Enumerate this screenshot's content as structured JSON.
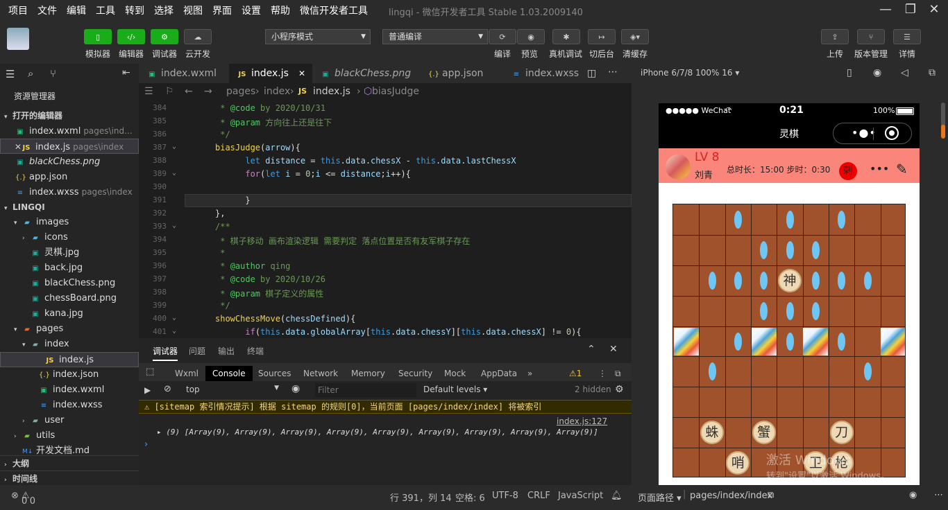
{
  "menubar": {
    "items": [
      "项目",
      "文件",
      "编辑",
      "工具",
      "转到",
      "选择",
      "视图",
      "界面",
      "设置",
      "帮助",
      "微信开发者工具"
    ],
    "title": "lingqi - 微信开发者工具 Stable 1.03.2009140"
  },
  "toolbar": {
    "simulator": "模拟器",
    "editor": "编辑器",
    "debugger": "调试器",
    "cloud": "云开发",
    "mode": "小程序模式",
    "compile_mode": "普通编译",
    "compile": "编译",
    "preview": "预览",
    "real_debug": "真机调试",
    "background": "切后台",
    "clear_cache": "清缓存",
    "upload": "上传",
    "version": "版本管理",
    "details": "详情"
  },
  "sidebar": {
    "title": "资源管理器",
    "open_editors": "打开的编辑器",
    "open_files": [
      {
        "name": "index.wxml",
        "path": "pages\\ind...",
        "type": "wxml"
      },
      {
        "name": "index.js",
        "path": "pages\\index",
        "type": "js"
      },
      {
        "name": "blackChess.png",
        "path": "",
        "type": "png"
      },
      {
        "name": "app.json",
        "path": "",
        "type": "json"
      },
      {
        "name": "index.wxss",
        "path": "pages\\index",
        "type": "wxss"
      }
    ],
    "project": "LINGQI",
    "tree": [
      {
        "name": "images",
        "type": "fold",
        "depth": 1,
        "open": true
      },
      {
        "name": "icons",
        "type": "fold",
        "depth": 2,
        "open": false
      },
      {
        "name": "灵棋.jpg",
        "type": "png",
        "depth": 2
      },
      {
        "name": "back.jpg",
        "type": "png",
        "depth": 2
      },
      {
        "name": "blackChess.png",
        "type": "png",
        "depth": 2
      },
      {
        "name": "chessBoard.png",
        "type": "png",
        "depth": 2
      },
      {
        "name": "kana.jpg",
        "type": "png",
        "depth": 2
      },
      {
        "name": "pages",
        "type": "fold",
        "depth": 1,
        "open": true
      },
      {
        "name": "index",
        "type": "fold",
        "depth": 2,
        "open": true
      },
      {
        "name": "index.js",
        "type": "js",
        "depth": 3
      },
      {
        "name": "index.json",
        "type": "json",
        "depth": 3
      },
      {
        "name": "index.wxml",
        "type": "wxml",
        "depth": 3
      },
      {
        "name": "index.wxss",
        "type": "wxss",
        "depth": 3
      },
      {
        "name": "user",
        "type": "fold",
        "depth": 2,
        "open": false
      },
      {
        "name": "utils",
        "type": "fold",
        "depth": 1,
        "open": false
      },
      {
        "name": "开发文档.md",
        "type": "md",
        "depth": 1
      }
    ],
    "outline": "大纲",
    "timeline": "时间线"
  },
  "tabs": [
    "index.wxml",
    "index.js",
    "blackChess.png",
    "app.json",
    "index.wxss"
  ],
  "breadcrumb": [
    "pages",
    "index",
    "index.js",
    "biasJudge"
  ],
  "editor": {
    "lines": [
      {
        "n": "384",
        "html": "<span class=\"cm\"> * </span><span class=\"cmk\">@code</span><span class=\"cm\"> by 2020/10/31</span>"
      },
      {
        "n": "385",
        "html": "<span class=\"cm\"> * </span><span class=\"cmk\">@param</span><span class=\"cm\"> 方向往上还是往下</span>"
      },
      {
        "n": "386",
        "html": "<span class=\"cm\"> */</span>"
      },
      {
        "n": "387",
        "html": "<span class=\"fn\">biasJudge</span>(<span class=\"pr\">arrow</span>){"
      },
      {
        "n": "388",
        "html": "      <span class=\"kw\">let</span> <span class=\"pr\">distance</span> = <span class=\"kw\">this</span>.<span class=\"pr\">data</span>.<span class=\"pr\">chessX</span> - <span class=\"kw\">this</span>.<span class=\"pr\">data</span>.<span class=\"pr\">lastChessX</span>"
      },
      {
        "n": "389",
        "html": "      <span class=\"pm\">for</span>(<span class=\"kw\">let</span> <span class=\"pr\">i</span> = <span class=\"num\">0</span>;<span class=\"pr\">i</span> &lt;= <span class=\"pr\">distance</span>;<span class=\"pr\">i</span>++){"
      },
      {
        "n": "390",
        "html": ""
      },
      {
        "n": "391",
        "html": "      }"
      },
      {
        "n": "392",
        "html": "},"
      },
      {
        "n": "393",
        "html": "<span class=\"cm\">/**</span>"
      },
      {
        "n": "394",
        "html": "<span class=\"cm\"> * 棋子移动 画布渲染逻辑 需要判定 落点位置是否有友军棋子存在</span>"
      },
      {
        "n": "395",
        "html": "<span class=\"cm\"> *</span>"
      },
      {
        "n": "396",
        "html": "<span class=\"cm\"> * </span><span class=\"cmk\">@author</span><span class=\"cm\"> qing</span>"
      },
      {
        "n": "397",
        "html": "<span class=\"cm\"> * </span><span class=\"cmk\">@code</span><span class=\"cm\"> by 2020/10/26</span>"
      },
      {
        "n": "398",
        "html": "<span class=\"cm\"> * </span><span class=\"cmk\">@param</span><span class=\"cm\"> 棋子定义的属性</span>"
      },
      {
        "n": "399",
        "html": "<span class=\"cm\"> */</span>"
      },
      {
        "n": "400",
        "html": "<span class=\"fn\">showChessMove</span>(<span class=\"pr\">chessDefined</span>){"
      },
      {
        "n": "401",
        "html": "      <span class=\"pm\">if</span>(<span class=\"kw\">this</span>.<span class=\"pr\">data</span>.<span class=\"pr\">globalArray</span>[<span class=\"kw\">this</span>.<span class=\"pr\">data</span>.<span class=\"pr\">chessY</span>][<span class=\"kw\">this</span>.<span class=\"pr\">data</span>.<span class=\"pr\">chessX</span>] != <span class=\"num\">0</span>){"
      }
    ]
  },
  "devtools": {
    "tabs": [
      "调试器",
      "问题",
      "输出",
      "终端"
    ],
    "panel_tabs": [
      "Wxml",
      "Console",
      "Sources",
      "Network",
      "Memory",
      "Security",
      "Mock",
      "AppData"
    ],
    "warn_count": "1",
    "context": "top",
    "filter_placeholder": "Filter",
    "levels": "Default levels",
    "hidden": "2 hidden",
    "warning": "[sitemap 索引情况提示] 根据 sitemap 的规则[0]，当前页面 [pages/index/index] 将被索引",
    "source": "index.js:127",
    "log": "(9) [Array(9), Array(9), Array(9), Array(9), Array(9), Array(9), Array(9), Array(9), Array(9)]"
  },
  "statusbar": {
    "errors": "0",
    "warnings": "0",
    "position": "行 391，列 14",
    "spaces": "空格: 6",
    "encoding": "UTF-8",
    "eol": "CRLF",
    "language": "JavaScript"
  },
  "simulator": {
    "device": "iPhone 6/7/8 100% 16",
    "carrier": "●●●●● WeChat",
    "time": "0:21",
    "battery": "100%",
    "nav_title": "灵棋",
    "level": "LV 8",
    "username": "刘青",
    "total_time_label": "总时长：",
    "total_time": "15:00",
    "step_time_label": "步时：",
    "step_time": "0:30",
    "badge": "刺",
    "page_path_label": "页面路径",
    "page_path": "pages/index/index",
    "watermark1": "激活 Windows",
    "watermark2": "转到\"设置\"以激活 Windows。"
  },
  "board": {
    "pieces": [
      {
        "char": "神",
        "col": 4,
        "row": 2
      },
      {
        "char": "蛛",
        "col": 1,
        "row": 7
      },
      {
        "char": "蟹",
        "col": 3,
        "row": 7
      },
      {
        "char": "刀",
        "col": 6,
        "row": 7
      },
      {
        "char": "哨",
        "col": 2,
        "row": 8
      },
      {
        "char": "卫",
        "col": 5,
        "row": 8
      },
      {
        "char": "枪",
        "col": 6,
        "row": 8
      }
    ],
    "dots": [
      [
        2,
        0
      ],
      [
        4,
        0
      ],
      [
        6,
        0
      ],
      [
        3,
        1
      ],
      [
        4,
        1
      ],
      [
        5,
        1
      ],
      [
        1,
        2
      ],
      [
        2,
        2
      ],
      [
        3,
        2
      ],
      [
        5,
        2
      ],
      [
        6,
        2
      ],
      [
        7,
        2
      ],
      [
        3,
        3
      ],
      [
        4,
        3
      ],
      [
        5,
        3
      ],
      [
        2,
        4
      ],
      [
        4,
        4
      ],
      [
        6,
        4
      ],
      [
        1,
        5
      ],
      [
        7,
        5
      ]
    ],
    "cards": [
      0,
      3,
      5,
      8
    ]
  }
}
